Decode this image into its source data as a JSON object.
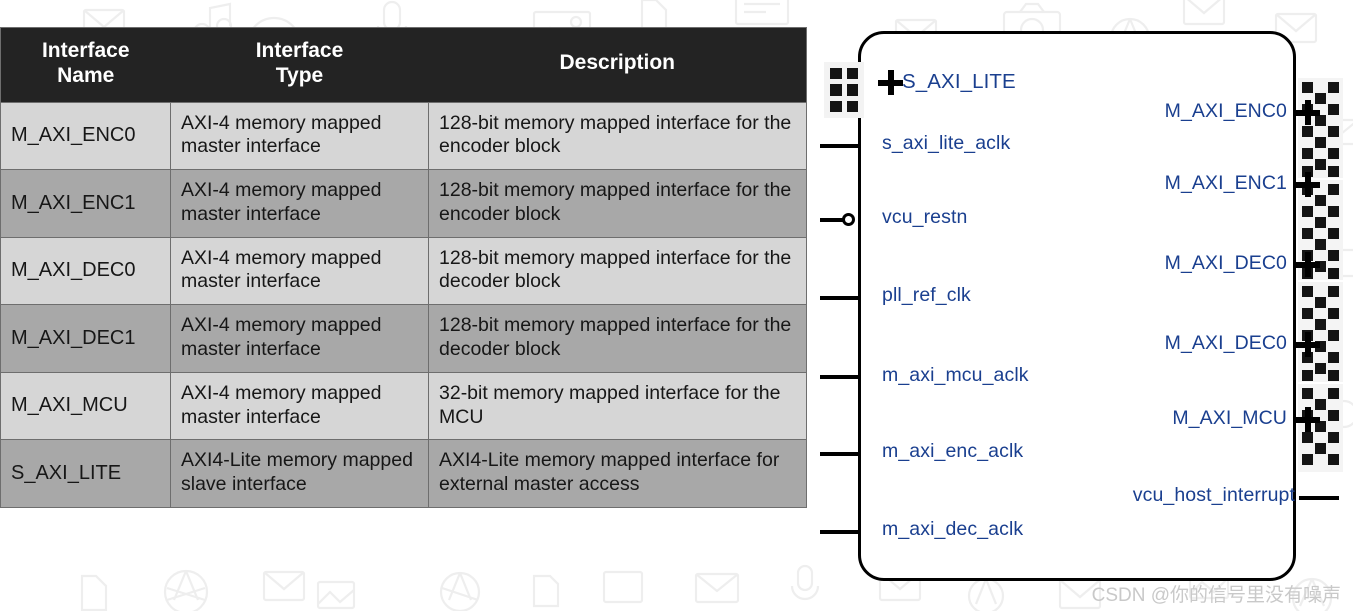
{
  "table": {
    "headers": [
      "Interface\nName",
      "Interface\nType",
      "Description"
    ],
    "header_name": "Interface Name",
    "header_type": "Interface Type",
    "header_desc": "Description",
    "rows": [
      {
        "name": "M_AXI_ENC0",
        "type": "AXI-4 memory mapped master interface",
        "description": "128-bit memory mapped interface for the encoder block"
      },
      {
        "name": "M_AXI_ENC1",
        "type": "AXI-4 memory mapped master interface",
        "description": "128-bit memory mapped interface for the encoder block"
      },
      {
        "name": "M_AXI_DEC0",
        "type": "AXI-4 memory mapped master interface",
        "description": "128-bit memory mapped interface for the decoder block"
      },
      {
        "name": "M_AXI_DEC1",
        "type": "AXI-4 memory mapped master interface",
        "description": "128-bit memory mapped interface for the decoder block"
      },
      {
        "name": "M_AXI_MCU",
        "type": "AXI-4 memory mapped master interface",
        "description": "32-bit memory mapped interface for the MCU"
      },
      {
        "name": "S_AXI_LITE",
        "type": "AXI4-Lite memory mapped slave interface",
        "description": "AXI4-Lite memory mapped interface for external master access"
      }
    ]
  },
  "diagram": {
    "left_bus_ports": [
      {
        "label": "S_AXI_LITE",
        "icon": "plus-expand-icon"
      }
    ],
    "left_ports": [
      {
        "label": "s_axi_lite_aclk",
        "inverted": false
      },
      {
        "label": "vcu_restn",
        "inverted": true
      },
      {
        "label": "pll_ref_clk",
        "inverted": false
      },
      {
        "label": "m_axi_mcu_aclk",
        "inverted": false
      },
      {
        "label": "m_axi_enc_aclk",
        "inverted": false
      },
      {
        "label": "m_axi_dec_aclk",
        "inverted": false
      }
    ],
    "right_bus_ports": [
      {
        "label": "M_AXI_ENC0",
        "icon": "plus-expand-icon"
      },
      {
        "label": "M_AXI_ENC1",
        "icon": "plus-expand-icon"
      },
      {
        "label": "M_AXI_DEC0",
        "icon": "plus-expand-icon"
      },
      {
        "label": "M_AXI_DEC0",
        "icon": "plus-expand-icon"
      },
      {
        "label": "M_AXI_MCU",
        "icon": "plus-expand-icon"
      }
    ],
    "right_ports": [
      {
        "label": "vcu_host_interrupt"
      }
    ]
  },
  "watermark": {
    "text": "CSDN @你的信号里没有噪声"
  },
  "colors": {
    "header_bg": "#232323",
    "row_odd": "#d6d6d6",
    "row_even": "#a8a8a8",
    "port_label": "#1a3f8f",
    "border": "#6e6e6e"
  }
}
